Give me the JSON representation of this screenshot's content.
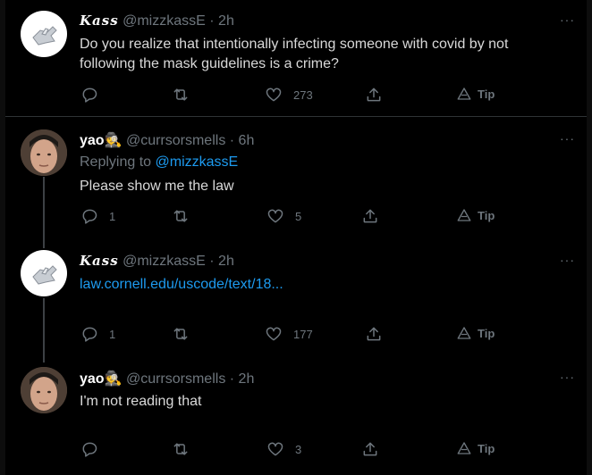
{
  "tweets": [
    {
      "author_name": "Kass",
      "handle": "@mizzkassE",
      "time": "2h",
      "text": "Do you realize that intentionally infecting someone with covid by not following the mask guidelines is a crime?",
      "replies": "",
      "likes": "273",
      "tip_label": "Tip"
    },
    {
      "author_name": "yao",
      "emoji": "🕵",
      "handle": "@currsorsmells",
      "time": "6h",
      "replying_prefix": "Replying to",
      "replying_to": "@mizzkassE",
      "text": "Please show me the law",
      "replies": "1",
      "likes": "5",
      "tip_label": "Tip"
    },
    {
      "author_name": "Kass",
      "handle": "@mizzkassE",
      "time": "2h",
      "link": "law.cornell.edu/uscode/text/18...",
      "replies": "1",
      "likes": "177",
      "tip_label": "Tip"
    },
    {
      "author_name": "yao",
      "emoji": "🕵",
      "handle": "@currsorsmells",
      "time": "2h",
      "text": "I'm not reading that",
      "replies": "",
      "likes": "3",
      "tip_label": "Tip"
    }
  ],
  "separator": "·",
  "more_label": "···",
  "icons": {
    "reply": "reply-icon",
    "retweet": "retweet-icon",
    "like": "heart-icon",
    "share": "share-icon",
    "tip": "tip-icon"
  },
  "colors": {
    "background": "#000000",
    "text": "#d9d9d9",
    "muted": "#6e767d",
    "link": "#1d9bf0",
    "divider": "#2f3336"
  }
}
